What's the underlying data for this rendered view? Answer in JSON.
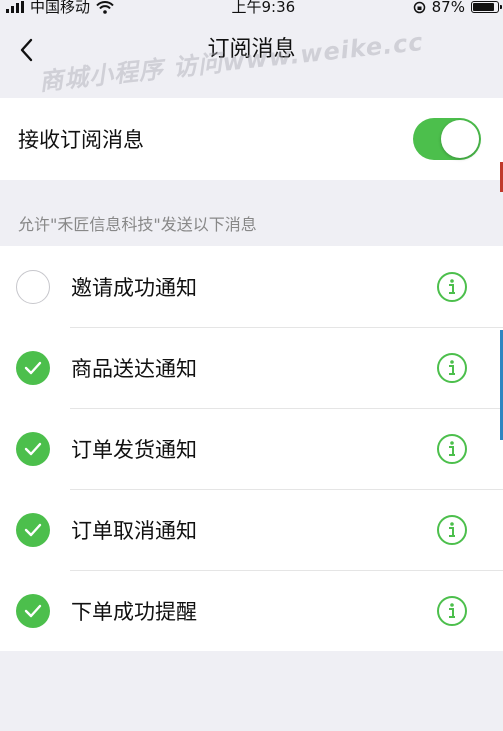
{
  "status_bar": {
    "carrier": "中国移动",
    "time": "上午9:36",
    "battery_percent": "87%",
    "battery_level": 0.87
  },
  "nav": {
    "title": "订阅消息",
    "watermark": "商城小程序 访问www.weike.cc"
  },
  "subscription": {
    "label": "接收订阅消息",
    "enabled": true
  },
  "hint": "允许\"禾匠信息科技\"发送以下消息",
  "items": [
    {
      "label": "邀请成功通知",
      "checked": false
    },
    {
      "label": "商品送达通知",
      "checked": true
    },
    {
      "label": "订单发货通知",
      "checked": true
    },
    {
      "label": "订单取消通知",
      "checked": true
    },
    {
      "label": "下单成功提醒",
      "checked": true
    }
  ],
  "colors": {
    "accent": "#4cbf4c",
    "background": "#efeff4"
  },
  "icons": {
    "back": "chevron-left-icon",
    "info": "info-circle-icon",
    "check": "checkmark-icon"
  }
}
